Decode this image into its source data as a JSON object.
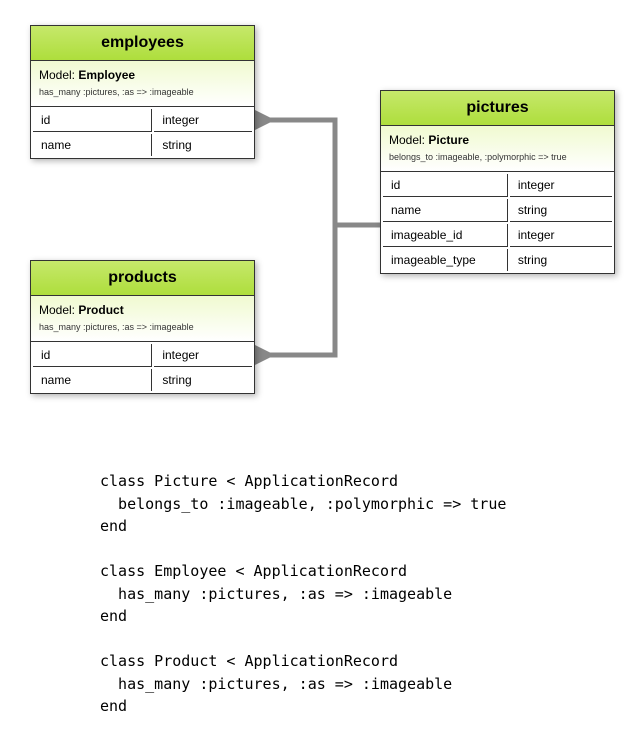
{
  "entities": {
    "employees": {
      "title": "employees",
      "model_label": "Model:",
      "model_name": "Employee",
      "association": "has_many :pictures, :as => :imageable",
      "fields": [
        {
          "name": "id",
          "type": "integer"
        },
        {
          "name": "name",
          "type": "string"
        }
      ]
    },
    "products": {
      "title": "products",
      "model_label": "Model:",
      "model_name": "Product",
      "association": "has_many :pictures, :as => :imageable",
      "fields": [
        {
          "name": "id",
          "type": "integer"
        },
        {
          "name": "name",
          "type": "string"
        }
      ]
    },
    "pictures": {
      "title": "pictures",
      "model_label": "Model:",
      "model_name": "Picture",
      "association": "belongs_to :imageable, :polymorphic => true",
      "fields": [
        {
          "name": "id",
          "type": "integer"
        },
        {
          "name": "name",
          "type": "string"
        },
        {
          "name": "imageable_id",
          "type": "integer"
        },
        {
          "name": "imageable_type",
          "type": "string"
        }
      ]
    }
  },
  "code": "class Picture < ApplicationRecord\n  belongs_to :imageable, :polymorphic => true\nend\n\nclass Employee < ApplicationRecord\n  has_many :pictures, :as => :imageable\nend\n\nclass Product < ApplicationRecord\n  has_many :pictures, :as => :imageable\nend"
}
